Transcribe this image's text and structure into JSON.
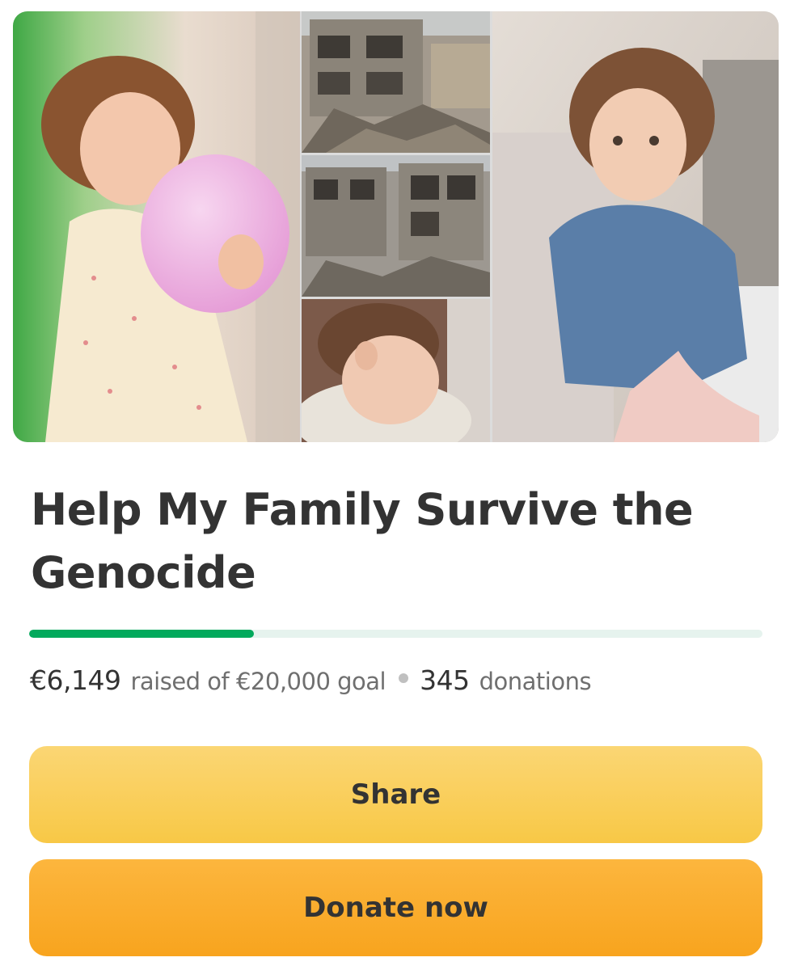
{
  "campaign": {
    "title": "Help My Family Survive the Genocide",
    "progress": {
      "raised_amount": "€6,149",
      "raised_text": "raised of €20,000 goal",
      "donation_count": "345",
      "donation_text": "donations",
      "fraction": 0.307,
      "color": "#02a95c"
    }
  },
  "actions": {
    "share_label": "Share",
    "donate_label": "Donate now",
    "share_color": "#f8c846",
    "donate_color": "#f8a41e"
  }
}
